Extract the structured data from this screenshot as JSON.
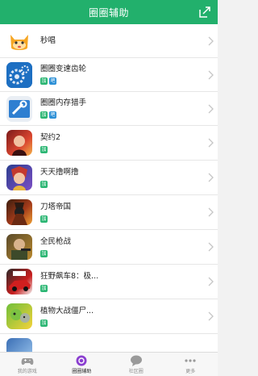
{
  "header": {
    "title": "圈圈辅助"
  },
  "apps": [
    {
      "name": "秒唱",
      "tags": []
    },
    {
      "name": "圈圈变速齿轮",
      "tags": [
        "加",
        "吧"
      ]
    },
    {
      "name": "圈圈内存猎手",
      "tags": [
        "加",
        "吧"
      ]
    },
    {
      "name": "契约2",
      "tags": [
        "加"
      ]
    },
    {
      "name": "天天撸啊撸",
      "tags": [
        "加"
      ]
    },
    {
      "name": "刀塔帝国",
      "tags": [
        "加"
      ]
    },
    {
      "name": "全民枪战",
      "tags": [
        "加"
      ]
    },
    {
      "name": "狂野飙车8：极...",
      "tags": [
        "加"
      ]
    },
    {
      "name": "植物大战僵尸...",
      "tags": [
        "加"
      ]
    }
  ],
  "tabbar": {
    "tabs": [
      {
        "label": "我的游戏"
      },
      {
        "label": "圈圈辅助"
      },
      {
        "label": "社区圈"
      },
      {
        "label": "更多"
      }
    ],
    "active": "圈圈辅助"
  },
  "colors": {
    "brand": "#22b06c",
    "tag_green": "#2bb673",
    "tag_blue": "#2b8fd6"
  }
}
